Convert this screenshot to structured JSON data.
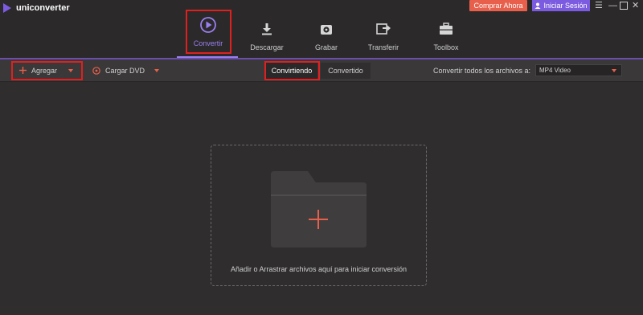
{
  "app": {
    "name": "uniconverter"
  },
  "header": {
    "buy_label": "Comprar Ahora",
    "login_label": "Iniciar Sesión"
  },
  "nav": [
    {
      "label": "Convertir",
      "icon": "play-circle-icon",
      "active": true
    },
    {
      "label": "Descargar",
      "icon": "download-icon",
      "active": false
    },
    {
      "label": "Grabar",
      "icon": "disc-icon",
      "active": false
    },
    {
      "label": "Transferir",
      "icon": "transfer-icon",
      "active": false
    },
    {
      "label": "Toolbox",
      "icon": "toolbox-icon",
      "active": false
    }
  ],
  "toolbar": {
    "add_label": "Agregar",
    "load_dvd_label": "Cargar DVD",
    "tabs": [
      {
        "label": "Convirtiendo",
        "active": true
      },
      {
        "label": "Convertido",
        "active": false
      }
    ],
    "convert_all_label": "Convertir todos los archivos a:",
    "format_value": "MP4 Video"
  },
  "dropzone": {
    "text": "Añadir o Arrastrar archivos aquí para iniciar conversión"
  },
  "colors": {
    "accent": "#7b5be0",
    "buy": "#e8604c",
    "highlight_box": "#e02020",
    "background": "#2f2d2d"
  }
}
